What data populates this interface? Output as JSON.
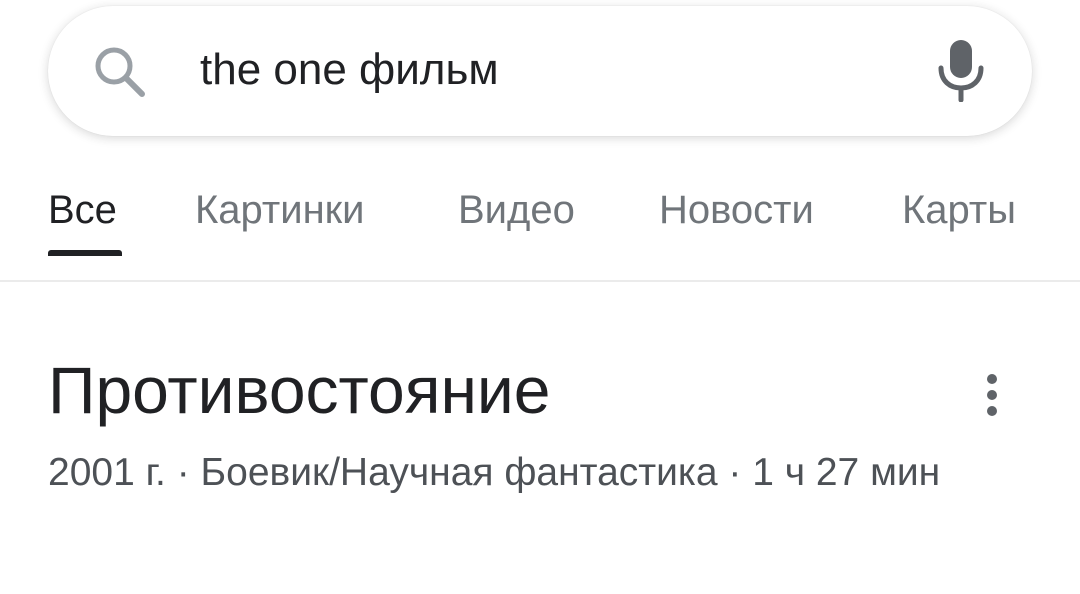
{
  "search": {
    "query": "the one фильм",
    "search_icon": "search-icon",
    "mic_icon": "mic-icon"
  },
  "tabs": [
    {
      "label": "Все",
      "active": true
    },
    {
      "label": "Картинки",
      "active": false
    },
    {
      "label": "Видео",
      "active": false
    },
    {
      "label": "Новости",
      "active": false
    },
    {
      "label": "Карты",
      "active": false
    }
  ],
  "knowledge_panel": {
    "title": "Противостояние",
    "subtitle": "2001 г. · Боевик/Научная фантастика · 1 ч 27 мин",
    "more_icon": "more-vert-icon"
  },
  "colors": {
    "text_primary": "#202124",
    "text_secondary": "#70757a",
    "icon_gray": "#9aa0a6"
  }
}
